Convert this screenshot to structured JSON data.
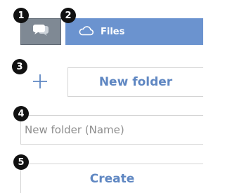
{
  "callouts": [
    "1",
    "2",
    "3",
    "4",
    "5"
  ],
  "toolbar": {
    "chat_icon": "chat-bubbles-icon",
    "files_tab": {
      "icon": "cloud-icon",
      "label": "Files"
    }
  },
  "actions": {
    "add_icon": "plus-icon",
    "new_folder_label": "New folder"
  },
  "form": {
    "name_placeholder": "New folder (Name)",
    "name_value": "",
    "create_label": "Create"
  },
  "colors": {
    "tab_blue": "#6b93cf",
    "chat_gray": "#7f8994",
    "link_blue": "#5f87c2",
    "border": "#d4d4d4"
  }
}
